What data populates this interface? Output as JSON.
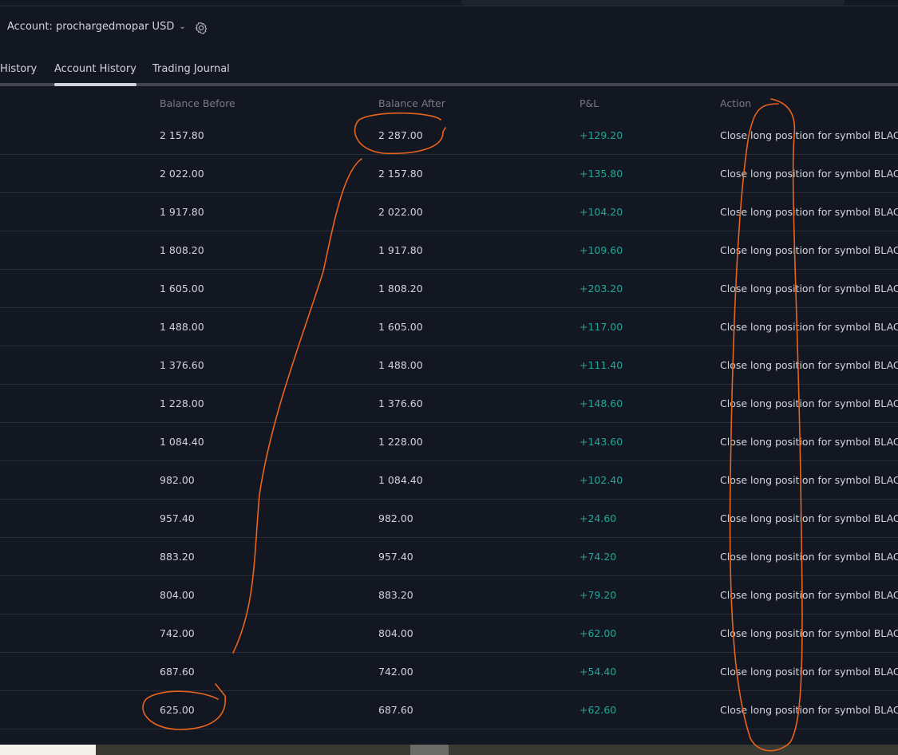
{
  "header": {
    "account_label": "Account: prochargedmopar USD",
    "icons": [
      "chevron-down-icon",
      "gear-icon"
    ]
  },
  "tabs": [
    {
      "label": "History",
      "active": false
    },
    {
      "label": "Account History",
      "active": true
    },
    {
      "label": "Trading Journal",
      "active": false
    }
  ],
  "table": {
    "columns": [
      "Balance Before",
      "Balance After",
      "P&L",
      "Action"
    ],
    "rows": [
      {
        "before": "2 157.80",
        "after": "2 287.00",
        "pnl": "+129.20",
        "action": "Close long position for symbol BLAC"
      },
      {
        "before": "2 022.00",
        "after": "2 157.80",
        "pnl": "+135.80",
        "action": "Close long position for symbol BLAC"
      },
      {
        "before": "1 917.80",
        "after": "2 022.00",
        "pnl": "+104.20",
        "action": "Close long position for symbol BLAC"
      },
      {
        "before": "1 808.20",
        "after": "1 917.80",
        "pnl": "+109.60",
        "action": "Close long position for symbol BLAC"
      },
      {
        "before": "1 605.00",
        "after": "1 808.20",
        "pnl": "+203.20",
        "action": "Close long position for symbol BLAC"
      },
      {
        "before": "1 488.00",
        "after": "1 605.00",
        "pnl": "+117.00",
        "action": "Close long position for symbol BLAC"
      },
      {
        "before": "1 376.60",
        "after": "1 488.00",
        "pnl": "+111.40",
        "action": "Close long position for symbol BLAC"
      },
      {
        "before": "1 228.00",
        "after": "1 376.60",
        "pnl": "+148.60",
        "action": "Close long position for symbol BLAC"
      },
      {
        "before": "1 084.40",
        "after": "1 228.00",
        "pnl": "+143.60",
        "action": "Close long position for symbol BLAC"
      },
      {
        "before": "982.00",
        "after": "1 084.40",
        "pnl": "+102.40",
        "action": "Close long position for symbol BLAC"
      },
      {
        "before": "957.40",
        "after": "982.00",
        "pnl": "+24.60",
        "action": "Close long position for symbol BLAC"
      },
      {
        "before": "883.20",
        "after": "957.40",
        "pnl": "+74.20",
        "action": "Close long position for symbol BLAC"
      },
      {
        "before": "804.00",
        "after": "883.20",
        "pnl": "+79.20",
        "action": "Close long position for symbol BLAC"
      },
      {
        "before": "742.00",
        "after": "804.00",
        "pnl": "+62.00",
        "action": "Close long position for symbol BLAC"
      },
      {
        "before": "687.60",
        "after": "742.00",
        "pnl": "+54.40",
        "action": "Close long position for symbol BLAC"
      },
      {
        "before": "625.00",
        "after": "687.60",
        "pnl": "+62.60",
        "action": "Close long position for symbol BLAC"
      }
    ]
  },
  "colors": {
    "background": "#131722",
    "positive": "#26a69a",
    "annotation": "#e8641c"
  }
}
